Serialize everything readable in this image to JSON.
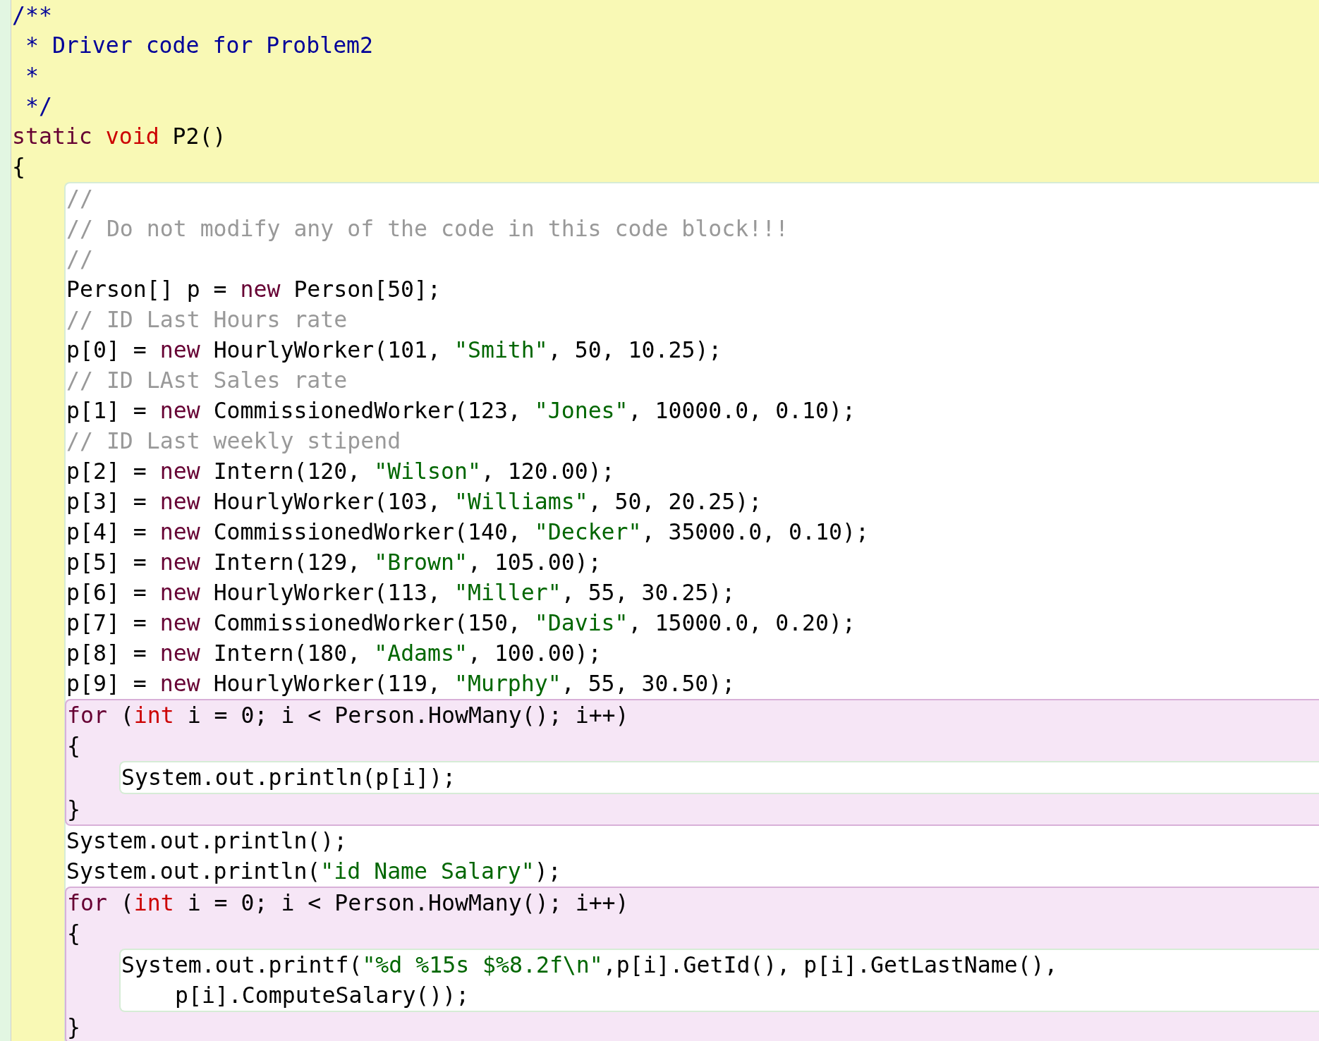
{
  "editor": {
    "scopes": [
      {
        "kind": "class",
        "children": [
          {
            "kind": "line",
            "tokens": [
              {
                "kind": "doc",
                "text": "/**"
              }
            ]
          },
          {
            "kind": "line",
            "tokens": [
              {
                "kind": "doc",
                "text": " * Driver code for Problem2"
              }
            ]
          },
          {
            "kind": "line",
            "tokens": [
              {
                "kind": "doc",
                "text": " *"
              }
            ]
          },
          {
            "kind": "line",
            "tokens": [
              {
                "kind": "doc",
                "text": " */"
              }
            ]
          },
          {
            "kind": "line",
            "tokens": [
              {
                "kind": "kw",
                "text": "static "
              },
              {
                "kind": "prim",
                "text": "void "
              },
              {
                "kind": "plain",
                "text": "P2()"
              }
            ]
          },
          {
            "kind": "line",
            "tokens": [
              {
                "kind": "plain",
                "text": "{"
              }
            ]
          },
          {
            "kind": "method",
            "children": [
              {
                "kind": "line",
                "tokens": [
                  {
                    "kind": "comment",
                    "text": "//"
                  }
                ]
              },
              {
                "kind": "line",
                "tokens": [
                  {
                    "kind": "comment",
                    "text": "// Do not modify any of the code in this code block!!!"
                  }
                ]
              },
              {
                "kind": "line",
                "tokens": [
                  {
                    "kind": "comment",
                    "text": "//"
                  }
                ]
              },
              {
                "kind": "line",
                "tokens": [
                  {
                    "kind": "plain",
                    "text": "Person[] p = "
                  },
                  {
                    "kind": "kw",
                    "text": "new "
                  },
                  {
                    "kind": "plain",
                    "text": "Person[50];"
                  }
                ]
              },
              {
                "kind": "line",
                "tokens": [
                  {
                    "kind": "comment",
                    "text": "// ID Last Hours rate"
                  }
                ]
              },
              {
                "kind": "line",
                "tokens": [
                  {
                    "kind": "plain",
                    "text": "p[0] = "
                  },
                  {
                    "kind": "kw",
                    "text": "new "
                  },
                  {
                    "kind": "plain",
                    "text": "HourlyWorker(101, "
                  },
                  {
                    "kind": "str",
                    "text": "\"Smith\""
                  },
                  {
                    "kind": "plain",
                    "text": ", 50, 10.25);"
                  }
                ]
              },
              {
                "kind": "line",
                "tokens": [
                  {
                    "kind": "comment",
                    "text": "// ID LAst Sales rate"
                  }
                ]
              },
              {
                "kind": "line",
                "tokens": [
                  {
                    "kind": "plain",
                    "text": "p[1] = "
                  },
                  {
                    "kind": "kw",
                    "text": "new "
                  },
                  {
                    "kind": "plain",
                    "text": "CommissionedWorker(123, "
                  },
                  {
                    "kind": "str",
                    "text": "\"Jones\""
                  },
                  {
                    "kind": "plain",
                    "text": ", 10000.0, 0.10);"
                  }
                ]
              },
              {
                "kind": "line",
                "tokens": [
                  {
                    "kind": "comment",
                    "text": "// ID Last weekly stipend"
                  }
                ]
              },
              {
                "kind": "line",
                "tokens": [
                  {
                    "kind": "plain",
                    "text": "p[2] = "
                  },
                  {
                    "kind": "kw",
                    "text": "new "
                  },
                  {
                    "kind": "plain",
                    "text": "Intern(120, "
                  },
                  {
                    "kind": "str",
                    "text": "\"Wilson\""
                  },
                  {
                    "kind": "plain",
                    "text": ", 120.00);"
                  }
                ]
              },
              {
                "kind": "line",
                "tokens": [
                  {
                    "kind": "plain",
                    "text": "p[3] = "
                  },
                  {
                    "kind": "kw",
                    "text": "new "
                  },
                  {
                    "kind": "plain",
                    "text": "HourlyWorker(103, "
                  },
                  {
                    "kind": "str",
                    "text": "\"Williams\""
                  },
                  {
                    "kind": "plain",
                    "text": ", 50, 20.25);"
                  }
                ]
              },
              {
                "kind": "line",
                "tokens": [
                  {
                    "kind": "plain",
                    "text": "p[4] = "
                  },
                  {
                    "kind": "kw",
                    "text": "new "
                  },
                  {
                    "kind": "plain",
                    "text": "CommissionedWorker(140, "
                  },
                  {
                    "kind": "str",
                    "text": "\"Decker\""
                  },
                  {
                    "kind": "plain",
                    "text": ", 35000.0, 0.10);"
                  }
                ]
              },
              {
                "kind": "line",
                "tokens": [
                  {
                    "kind": "plain",
                    "text": "p[5] = "
                  },
                  {
                    "kind": "kw",
                    "text": "new "
                  },
                  {
                    "kind": "plain",
                    "text": "Intern(129, "
                  },
                  {
                    "kind": "str",
                    "text": "\"Brown\""
                  },
                  {
                    "kind": "plain",
                    "text": ", 105.00);"
                  }
                ]
              },
              {
                "kind": "line",
                "tokens": [
                  {
                    "kind": "plain",
                    "text": "p[6] = "
                  },
                  {
                    "kind": "kw",
                    "text": "new "
                  },
                  {
                    "kind": "plain",
                    "text": "HourlyWorker(113, "
                  },
                  {
                    "kind": "str",
                    "text": "\"Miller\""
                  },
                  {
                    "kind": "plain",
                    "text": ", 55, 30.25);"
                  }
                ]
              },
              {
                "kind": "line",
                "tokens": [
                  {
                    "kind": "plain",
                    "text": "p[7] = "
                  },
                  {
                    "kind": "kw",
                    "text": "new "
                  },
                  {
                    "kind": "plain",
                    "text": "CommissionedWorker(150, "
                  },
                  {
                    "kind": "str",
                    "text": "\"Davis\""
                  },
                  {
                    "kind": "plain",
                    "text": ", 15000.0, 0.20);"
                  }
                ]
              },
              {
                "kind": "line",
                "tokens": [
                  {
                    "kind": "plain",
                    "text": "p[8] = "
                  },
                  {
                    "kind": "kw",
                    "text": "new "
                  },
                  {
                    "kind": "plain",
                    "text": "Intern(180, "
                  },
                  {
                    "kind": "str",
                    "text": "\"Adams\""
                  },
                  {
                    "kind": "plain",
                    "text": ", 100.00);"
                  }
                ]
              },
              {
                "kind": "line",
                "tokens": [
                  {
                    "kind": "plain",
                    "text": "p[9] = "
                  },
                  {
                    "kind": "kw",
                    "text": "new "
                  },
                  {
                    "kind": "plain",
                    "text": "HourlyWorker(119, "
                  },
                  {
                    "kind": "str",
                    "text": "\"Murphy\""
                  },
                  {
                    "kind": "plain",
                    "text": ", 55, 30.50);"
                  }
                ]
              },
              {
                "kind": "loop",
                "children": [
                  {
                    "kind": "line",
                    "tokens": [
                      {
                        "kind": "kw",
                        "text": "for "
                      },
                      {
                        "kind": "plain",
                        "text": "("
                      },
                      {
                        "kind": "prim",
                        "text": "int "
                      },
                      {
                        "kind": "plain",
                        "text": "i = 0; i < Person.HowMany(); i++)"
                      }
                    ]
                  },
                  {
                    "kind": "line",
                    "tokens": [
                      {
                        "kind": "plain",
                        "text": "{"
                      }
                    ]
                  },
                  {
                    "kind": "body",
                    "children": [
                      {
                        "kind": "line",
                        "tokens": [
                          {
                            "kind": "plain",
                            "text": "System.out.println(p[i]);"
                          }
                        ]
                      }
                    ]
                  },
                  {
                    "kind": "line",
                    "tokens": [
                      {
                        "kind": "plain",
                        "text": "}"
                      }
                    ]
                  }
                ]
              },
              {
                "kind": "line",
                "tokens": [
                  {
                    "kind": "plain",
                    "text": "System.out.println();"
                  }
                ]
              },
              {
                "kind": "line",
                "tokens": [
                  {
                    "kind": "plain",
                    "text": "System.out.println("
                  },
                  {
                    "kind": "str",
                    "text": "\"id Name Salary\""
                  },
                  {
                    "kind": "plain",
                    "text": ");"
                  }
                ]
              },
              {
                "kind": "loop",
                "children": [
                  {
                    "kind": "line",
                    "tokens": [
                      {
                        "kind": "kw",
                        "text": "for "
                      },
                      {
                        "kind": "plain",
                        "text": "("
                      },
                      {
                        "kind": "prim",
                        "text": "int "
                      },
                      {
                        "kind": "plain",
                        "text": "i = 0; i < Person.HowMany(); i++)"
                      }
                    ]
                  },
                  {
                    "kind": "line",
                    "tokens": [
                      {
                        "kind": "plain",
                        "text": "{"
                      }
                    ]
                  },
                  {
                    "kind": "body",
                    "children": [
                      {
                        "kind": "line",
                        "tokens": [
                          {
                            "kind": "plain",
                            "text": "System.out.printf("
                          },
                          {
                            "kind": "str",
                            "text": "\"%d %15s $%8.2f\\n\""
                          },
                          {
                            "kind": "plain",
                            "text": ",p[i].GetId(), p[i].GetLastName(),"
                          }
                        ]
                      },
                      {
                        "kind": "line",
                        "continuation": true,
                        "tokens": [
                          {
                            "kind": "plain",
                            "text": "p[i].ComputeSalary());"
                          }
                        ]
                      }
                    ]
                  },
                  {
                    "kind": "line",
                    "tokens": [
                      {
                        "kind": "plain",
                        "text": "}"
                      }
                    ]
                  }
                ]
              }
            ]
          }
        ]
      }
    ]
  }
}
